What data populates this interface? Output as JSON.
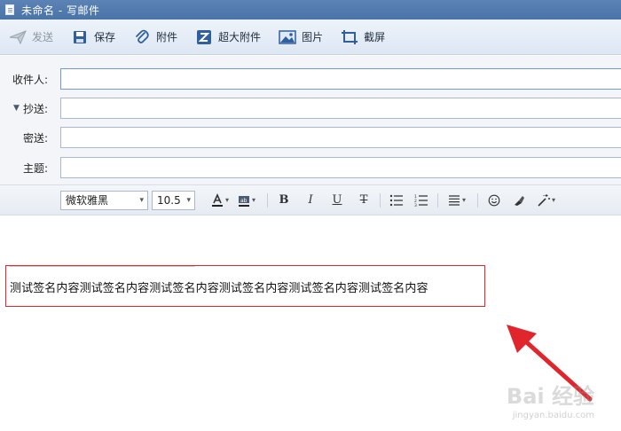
{
  "window": {
    "title": "未命名 - 写邮件"
  },
  "toolbar": {
    "buttons": [
      {
        "label": "发送",
        "icon": "send-icon",
        "enabled": false
      },
      {
        "label": "保存",
        "icon": "save-icon",
        "enabled": true
      },
      {
        "label": "附件",
        "icon": "paperclip-icon",
        "enabled": true
      },
      {
        "label": "超大附件",
        "icon": "large-attachment-icon",
        "enabled": true
      },
      {
        "label": "图片",
        "icon": "image-icon",
        "enabled": true
      },
      {
        "label": "截屏",
        "icon": "screenshot-icon",
        "enabled": true
      }
    ]
  },
  "fields": {
    "to": {
      "label": "收件人:",
      "value": ""
    },
    "cc": {
      "label": "抄送:",
      "value": ""
    },
    "bcc": {
      "label": "密送:",
      "value": ""
    },
    "subject": {
      "label": "主题:",
      "value": ""
    }
  },
  "format": {
    "font": "微软雅黑",
    "size": "10.5"
  },
  "editor": {
    "signature": "测试签名内容测试签名内容测试签名内容测试签名内容测试签名内容测试签名内容"
  },
  "watermark": {
    "main": "Bai 经验",
    "sub": "jingyan.baidu.com"
  },
  "colors": {
    "highlight": "#e0252c",
    "titlebar": "#4a73a8"
  }
}
